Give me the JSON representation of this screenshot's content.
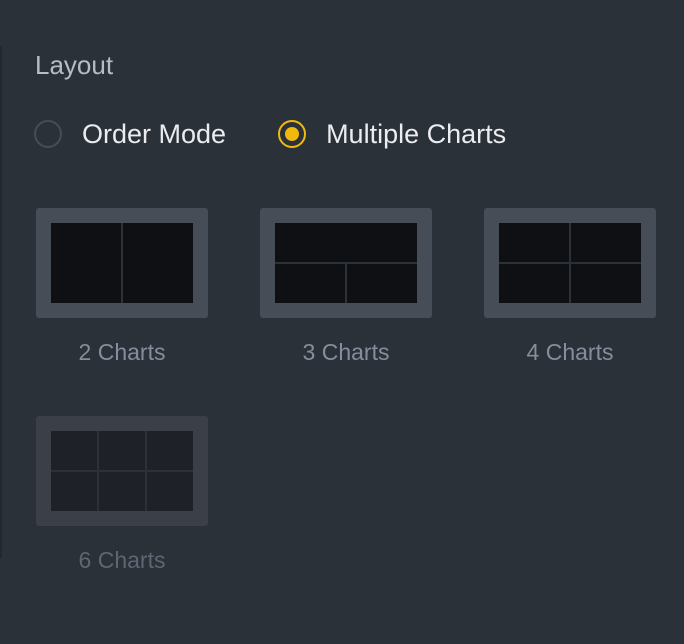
{
  "layout_panel": {
    "title": "Layout",
    "mode_options": [
      {
        "label": "Order Mode",
        "checked": false
      },
      {
        "label": "Multiple Charts",
        "checked": true
      }
    ],
    "chart_layouts": [
      {
        "label": "2 Charts",
        "enabled": true
      },
      {
        "label": "3 Charts",
        "enabled": true
      },
      {
        "label": "4 Charts",
        "enabled": true
      },
      {
        "label": "6 Charts",
        "enabled": false
      }
    ]
  },
  "colors": {
    "background": "#2b3139",
    "accent": "#f0b90b",
    "thumbnail_frame": "#474d57",
    "text_primary": "#eaecef",
    "text_secondary": "#848e9c"
  }
}
